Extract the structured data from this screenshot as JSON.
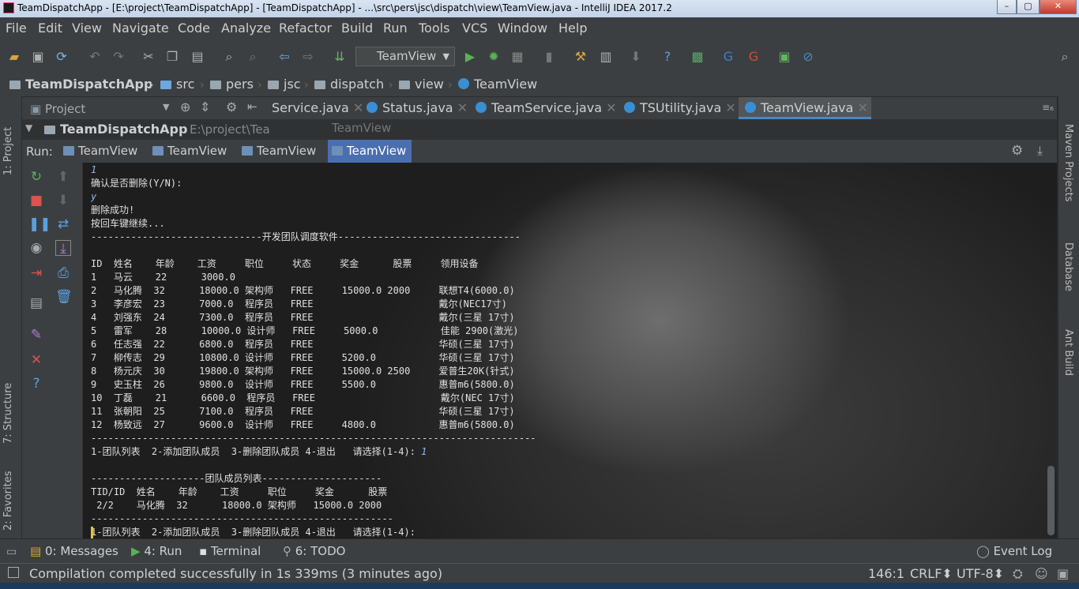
{
  "window": {
    "title": "TeamDispatchApp - [E:\\project\\TeamDispatchApp] - [TeamDispatchApp] - ...\\src\\pers\\jsc\\dispatch\\view\\TeamView.java - IntelliJ IDEA 2017.2"
  },
  "menu": [
    "File",
    "Edit",
    "View",
    "Navigate",
    "Code",
    "Analyze",
    "Refactor",
    "Build",
    "Run",
    "Tools",
    "VCS",
    "Window",
    "Help"
  ],
  "toolbar": {
    "run_config": "TeamView"
  },
  "breadcrumbs": [
    "TeamDispatchApp",
    "src",
    "pers",
    "jsc",
    "dispatch",
    "view",
    "TeamView"
  ],
  "project": {
    "label": "Project",
    "root": "TeamDispatchApp",
    "root_path": "E:\\project\\Tea",
    "overlay": "TeamView"
  },
  "editor_tabs": [
    "Service.java",
    "Status.java",
    "TeamService.java",
    "TSUtility.java",
    "TeamView.java"
  ],
  "run": {
    "label": "Run:",
    "tabs": [
      "TeamView",
      "TeamView",
      "TeamView",
      "TeamView"
    ]
  },
  "console": {
    "lines": [
      {
        "text": "1",
        "kind": "inp"
      },
      {
        "text": "确认是否删除(Y/N):",
        "kind": "out"
      },
      {
        "text": "y",
        "kind": "inp"
      },
      {
        "text": "删除成功!",
        "kind": "out"
      },
      {
        "text": "按回车键继续...",
        "kind": "out"
      },
      {
        "text": "------------------------------开发团队调度软件--------------------------------",
        "kind": "out"
      },
      {
        "text": "",
        "kind": "out"
      },
      {
        "text": "ID  姓名    年龄    工资     职位     状态     奖金      股票     领用设备",
        "kind": "out"
      },
      {
        "text": "1   马云    22      3000.0",
        "kind": "out"
      },
      {
        "text": "2   马化腾  32      18000.0 架构师   FREE     15000.0 2000     联想T4(6000.0)",
        "kind": "out"
      },
      {
        "text": "3   李彦宏  23      7000.0  程序员   FREE                      戴尔(NEC17寸)",
        "kind": "out"
      },
      {
        "text": "4   刘强东  24      7300.0  程序员   FREE                      戴尔(三星 17寸)",
        "kind": "out"
      },
      {
        "text": "5   雷军    28      10000.0 设计师   FREE     5000.0           佳能 2900(激光)",
        "kind": "out"
      },
      {
        "text": "6   任志强  22      6800.0  程序员   FREE                      华硕(三星 17寸)",
        "kind": "out"
      },
      {
        "text": "7   柳传志  29      10800.0 设计师   FREE     5200.0           华硕(三星 17寸)",
        "kind": "out"
      },
      {
        "text": "8   杨元庆  30      19800.0 架构师   FREE     15000.0 2500     爱普生20K(针式)",
        "kind": "out"
      },
      {
        "text": "9   史玉柱  26      9800.0  设计师   FREE     5500.0           惠普m6(5800.0)",
        "kind": "out"
      },
      {
        "text": "10  丁磊    21      6600.0  程序员   FREE                      戴尔(NEC 17寸)",
        "kind": "out"
      },
      {
        "text": "11  张朝阳  25      7100.0  程序员   FREE                      华硕(三星 17寸)",
        "kind": "out"
      },
      {
        "text": "12  杨致远  27      9600.0  设计师   FREE     4800.0           惠普m6(5800.0)",
        "kind": "out"
      },
      {
        "text": "------------------------------------------------------------------------------",
        "kind": "out"
      },
      {
        "text": "1-团队列表  2-添加团队成员  3-删除团队成员 4-退出   请选择(1-4): ",
        "kind": "out",
        "input": "1"
      },
      {
        "text": "",
        "kind": "out"
      },
      {
        "text": "--------------------团队成员列表---------------------",
        "kind": "out"
      },
      {
        "text": "TID/ID  姓名    年龄    工资     职位     奖金      股票",
        "kind": "out"
      },
      {
        "text": " 2/2    马化腾  32      18000.0 架构师   15000.0 2000",
        "kind": "out"
      },
      {
        "text": "-----------------------------------------------------",
        "kind": "out"
      },
      {
        "text": "1-团队列表  2-添加团队成员  3-删除团队成员 4-退出   请选择(1-4):",
        "kind": "out"
      }
    ]
  },
  "side_tabs": {
    "left": [
      "1: Project",
      "7: Structure",
      "2: Favorites"
    ],
    "right": [
      "Maven Projects",
      "Database",
      "Ant Build"
    ]
  },
  "bottom_tabs": [
    "0: Messages",
    "4: Run",
    "Terminal",
    "6: TODO"
  ],
  "event_log": "Event Log",
  "status": {
    "message": "Compilation completed successfully in 1s 339ms (3 minutes ago)",
    "position": "146:1",
    "line_sep": "CRLF",
    "encoding": "UTF-8"
  },
  "colors": {
    "accent": "#4a88c7",
    "run_tab_active": "#4b6eaf",
    "console_input": "#8fb8f0"
  }
}
